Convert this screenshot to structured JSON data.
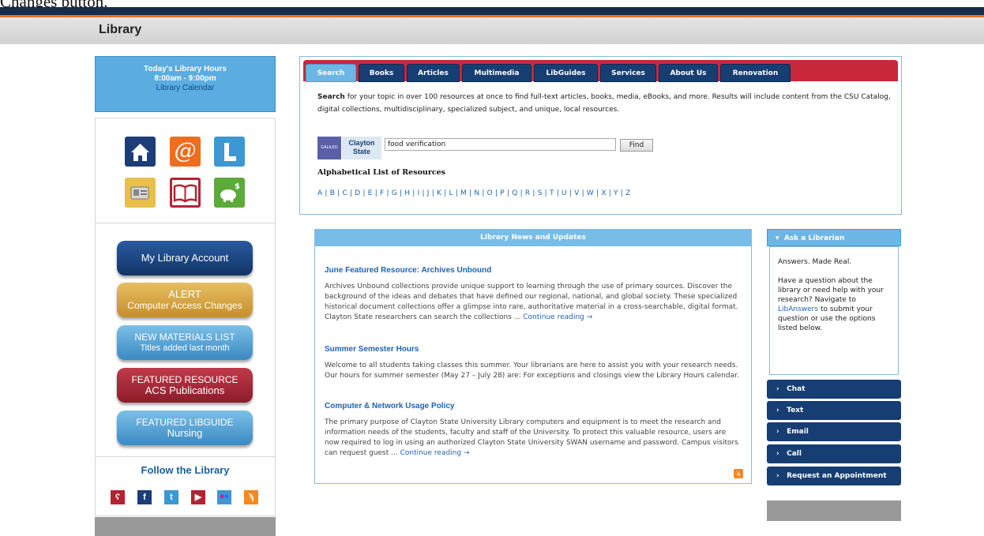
{
  "header": {
    "top_cut_text": "Changes button.",
    "title": "Library"
  },
  "hours": {
    "line1": "Today's Library Hours",
    "line2": "8:00am - 9:00pm",
    "link": "Library Calendar"
  },
  "quick_icons": [
    {
      "icon": "home-icon",
      "color": "#1c3d77"
    },
    {
      "icon": "at-email-icon",
      "color": "#ee6d1f"
    },
    {
      "icon": "letter-l-icon",
      "color": "#3c97d3"
    },
    {
      "icon": "id-card-icon",
      "color": "#e7bf49"
    },
    {
      "icon": "open-book-icon",
      "color": "#b42332"
    },
    {
      "icon": "piggy-bank-icon",
      "color": "#5caa3a"
    }
  ],
  "buttons": {
    "account": "My Library Account",
    "alert_line1": "ALERT",
    "alert_line2": "Computer Access Changes",
    "new_line1": "NEW MATERIALS LIST",
    "new_line2": "Titles added last month",
    "feat_line1": "FEATURED RESOURCE",
    "feat_line2": "ACS Publications",
    "guide_line1": "FEATURED LIBGUIDE",
    "guide_line2": "Nursing"
  },
  "follow": {
    "title": "Follow the Library",
    "icons": [
      "flickr-bird-icon",
      "facebook-icon",
      "twitter-icon",
      "youtube-icon",
      "flickr-icon",
      "rss-icon"
    ]
  },
  "search": {
    "tabs": [
      "Search",
      "Books",
      "Articles",
      "Multimedia",
      "LibGuides",
      "Services",
      "About Us",
      "Renovation"
    ],
    "desc_bold": "Search",
    "desc_rest": " for your topic in over 100 resources at once to find full-text articles, books, media, eBooks, and more. Results will include content from the CSU Catalog, digital collections, multidisciplinary, specialized subject, and unique, local resources.",
    "logo1": "GALILEO",
    "logo2_line1": "Clayton",
    "logo2_line2": "State",
    "input_value": "food verification",
    "find_label": "Find",
    "alpha_title": "Alphabetical List of Resources",
    "alpha_list": "A | B | C | D | E | F | G | H | I | J | K | L | M | N | O | P | Q | R | S | T | U | V | W | X | Y | Z"
  },
  "news": {
    "header": "Library News and Updates",
    "articles": [
      {
        "title": "June Featured Resource: Archives Unbound",
        "body": "Archives Unbound collections provide unique support to learning through the use of primary sources. Discover the background of the ideas and debates that have defined our regional, national, and global society. These specialized historical document collections offer a glimpse into rare, authoritative material in a cross-searchable, digital format. Clayton State researchers can search the collections ... ",
        "more": "Continue reading →"
      },
      {
        "title": "Summer Semester Hours",
        "body": "Welcome to all students taking classes this summer. Your librarians are here to assist you with your research needs. Our hours for summer semester (May 27 – July 28) are: For exceptions and closings view the Library Hours calendar.",
        "more": ""
      },
      {
        "title": "Computer & Network Usage Policy",
        "body": "The primary purpose of Clayton State University Library computers and equipment is to meet the research and information needs of the students, faculty and staff of the University. To protect this valuable resource, users are now required to log in using an authorized Clayton State University SWAN username and password. Campus visitors can request guest ... ",
        "more": "Continue reading →"
      }
    ]
  },
  "ask": {
    "header": "Ask a Librarian",
    "tagline": "Answers. Made Real.",
    "text_before": "Have a question about the library or need help with your research? Navigate to ",
    "link": "LibAnswers",
    "text_after": " to submit your question or use the options listed below.",
    "items": [
      "Chat",
      "Text",
      "Email",
      "Call",
      "Request an Appointment"
    ]
  }
}
